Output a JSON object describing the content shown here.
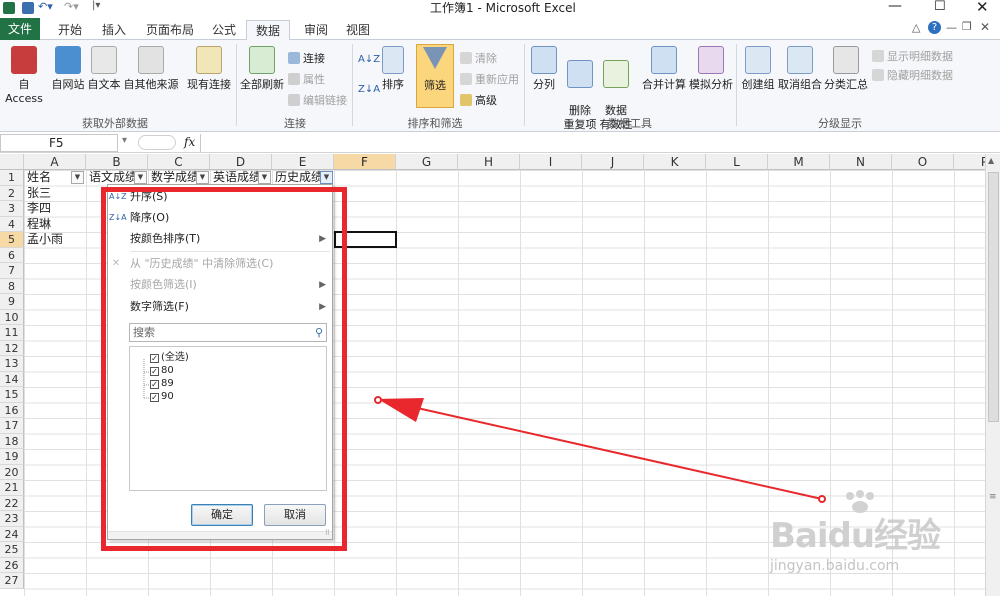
{
  "window": {
    "title": "工作簿1 - Microsoft Excel"
  },
  "tabs": [
    "文件",
    "开始",
    "插入",
    "页面布局",
    "公式",
    "数据",
    "审阅",
    "视图"
  ],
  "ribbon": {
    "get_external": {
      "buttons": [
        "自 Access",
        "自网站",
        "自文本",
        "自其他来源",
        "现有连接"
      ],
      "label": "获取外部数据"
    },
    "connections": {
      "refresh": "全部刷新",
      "items": [
        "连接",
        "属性",
        "编辑链接"
      ],
      "label": "连接"
    },
    "sort_filter": {
      "sort": "排序",
      "filter": "筛选",
      "items": [
        "清除",
        "重新应用",
        "高级"
      ],
      "label": "排序和筛选"
    },
    "data_tools": {
      "buttons": [
        "分列",
        "删除\n重复项",
        "数据\n有效性",
        "合并计算",
        "模拟分析"
      ],
      "label": "数据工具"
    },
    "outline": {
      "buttons": [
        "创建组",
        "取消组合",
        "分类汇总"
      ],
      "items": [
        "显示明细数据",
        "隐藏明细数据"
      ],
      "label": "分级显示"
    }
  },
  "formula_bar": {
    "name_box": "F5",
    "fx": "fx"
  },
  "grid": {
    "columns": [
      "A",
      "B",
      "C",
      "D",
      "E",
      "F",
      "G",
      "H",
      "I",
      "J",
      "K",
      "L",
      "M",
      "N",
      "O",
      "P"
    ],
    "rows": [
      "1",
      "2",
      "3",
      "4",
      "5",
      "6",
      "7",
      "8",
      "9",
      "10",
      "11",
      "12",
      "13",
      "14",
      "15",
      "16",
      "17",
      "18",
      "19",
      "20",
      "21",
      "22",
      "23",
      "24",
      "25",
      "26",
      "27"
    ],
    "headers": [
      "姓名",
      "语文成绩",
      "数学成绩",
      "英语成绩",
      "历史成绩"
    ],
    "names": [
      "张三",
      "李四",
      "程琳",
      "孟小雨"
    ]
  },
  "filter_menu": {
    "sort_asc": "升序(S)",
    "sort_desc": "降序(O)",
    "sort_color": "按颜色排序(T)",
    "clear": "从 \"历史成绩\" 中清除筛选(C)",
    "filter_color": "按颜色筛选(I)",
    "number_filter": "数字筛选(F)",
    "search_placeholder": "搜索",
    "list": [
      "(全选)",
      "80",
      "89",
      "90"
    ],
    "ok": "确定",
    "cancel": "取消"
  },
  "watermark": {
    "brand": "Baidu经验",
    "url": "jingyan.baidu.com"
  },
  "colors": {
    "excel_green": "#217346",
    "annotation_red": "#e8282c"
  }
}
